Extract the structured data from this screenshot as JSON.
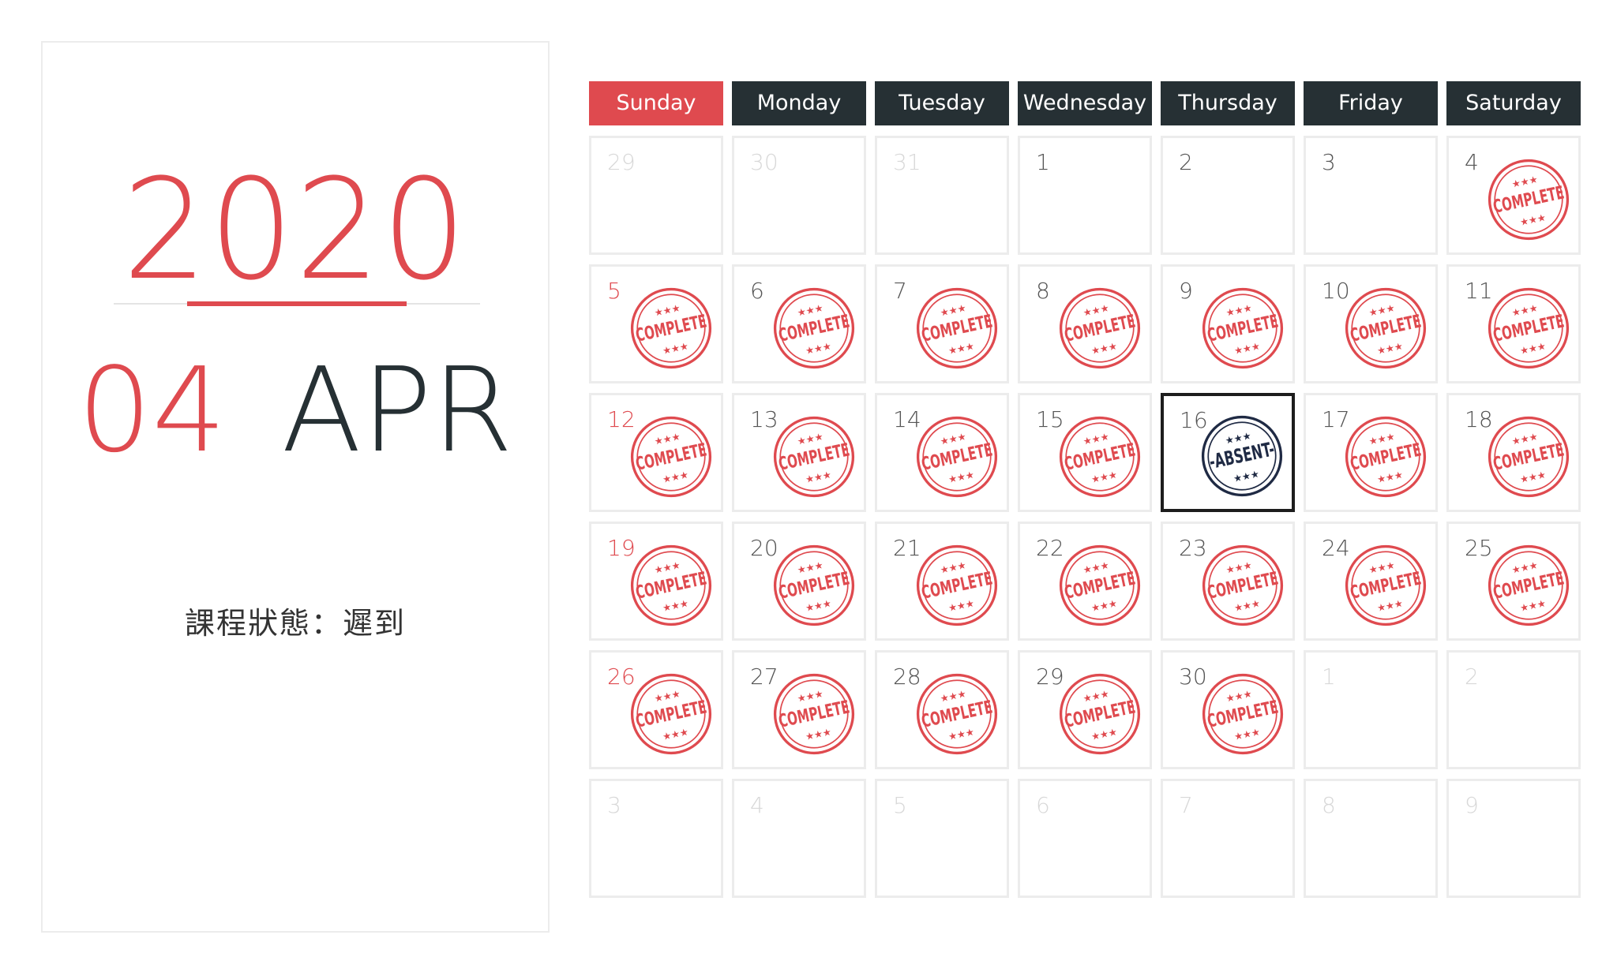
{
  "left_panel": {
    "year": "2020",
    "month_number": "04",
    "month_name": "APR",
    "status_text": "課程狀態：遲到"
  },
  "colors": {
    "accent_red": "#df4a4f",
    "dark": "#263034",
    "absent_navy": "#1f2a44"
  },
  "weekdays": [
    "Sunday",
    "Monday",
    "Tuesday",
    "Wednesday",
    "Thursday",
    "Friday",
    "Saturday"
  ],
  "stamp_text": {
    "complete": "COMPLETE",
    "absent": "-ABSENT-",
    "stars": "★★★"
  },
  "days": [
    {
      "n": "29",
      "other": true,
      "stamp": ""
    },
    {
      "n": "30",
      "other": true,
      "stamp": ""
    },
    {
      "n": "31",
      "other": true,
      "stamp": ""
    },
    {
      "n": "1",
      "other": false,
      "stamp": ""
    },
    {
      "n": "2",
      "other": false,
      "stamp": ""
    },
    {
      "n": "3",
      "other": false,
      "stamp": ""
    },
    {
      "n": "4",
      "other": false,
      "stamp": "complete"
    },
    {
      "n": "5",
      "other": false,
      "stamp": "complete"
    },
    {
      "n": "6",
      "other": false,
      "stamp": "complete"
    },
    {
      "n": "7",
      "other": false,
      "stamp": "complete"
    },
    {
      "n": "8",
      "other": false,
      "stamp": "complete"
    },
    {
      "n": "9",
      "other": false,
      "stamp": "complete"
    },
    {
      "n": "10",
      "other": false,
      "stamp": "complete"
    },
    {
      "n": "11",
      "other": false,
      "stamp": "complete"
    },
    {
      "n": "12",
      "other": false,
      "stamp": "complete"
    },
    {
      "n": "13",
      "other": false,
      "stamp": "complete"
    },
    {
      "n": "14",
      "other": false,
      "stamp": "complete"
    },
    {
      "n": "15",
      "other": false,
      "stamp": "complete"
    },
    {
      "n": "16",
      "other": false,
      "stamp": "absent",
      "highlight": true
    },
    {
      "n": "17",
      "other": false,
      "stamp": "complete"
    },
    {
      "n": "18",
      "other": false,
      "stamp": "complete"
    },
    {
      "n": "19",
      "other": false,
      "stamp": "complete"
    },
    {
      "n": "20",
      "other": false,
      "stamp": "complete"
    },
    {
      "n": "21",
      "other": false,
      "stamp": "complete"
    },
    {
      "n": "22",
      "other": false,
      "stamp": "complete"
    },
    {
      "n": "23",
      "other": false,
      "stamp": "complete"
    },
    {
      "n": "24",
      "other": false,
      "stamp": "complete"
    },
    {
      "n": "25",
      "other": false,
      "stamp": "complete"
    },
    {
      "n": "26",
      "other": false,
      "stamp": "complete"
    },
    {
      "n": "27",
      "other": false,
      "stamp": "complete"
    },
    {
      "n": "28",
      "other": false,
      "stamp": "complete"
    },
    {
      "n": "29",
      "other": false,
      "stamp": "complete"
    },
    {
      "n": "30",
      "other": false,
      "stamp": "complete"
    },
    {
      "n": "1",
      "other": true,
      "stamp": ""
    },
    {
      "n": "2",
      "other": true,
      "stamp": ""
    },
    {
      "n": "3",
      "other": true,
      "stamp": ""
    },
    {
      "n": "4",
      "other": true,
      "stamp": ""
    },
    {
      "n": "5",
      "other": true,
      "stamp": ""
    },
    {
      "n": "6",
      "other": true,
      "stamp": ""
    },
    {
      "n": "7",
      "other": true,
      "stamp": ""
    },
    {
      "n": "8",
      "other": true,
      "stamp": ""
    },
    {
      "n": "9",
      "other": true,
      "stamp": ""
    }
  ]
}
